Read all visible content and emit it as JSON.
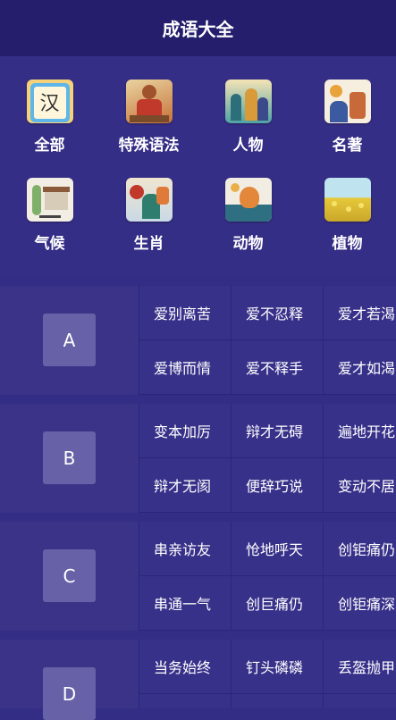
{
  "header": {
    "title": "成语大全"
  },
  "categories": [
    {
      "label": "全部",
      "icon": "han-character-icon"
    },
    {
      "label": "特殊语法",
      "icon": "monkey-king-icon"
    },
    {
      "label": "人物",
      "icon": "people-icon"
    },
    {
      "label": "名著",
      "icon": "classics-icon"
    },
    {
      "label": "气候",
      "icon": "weather-icon"
    },
    {
      "label": "生肖",
      "icon": "zodiac-icon"
    },
    {
      "label": "动物",
      "icon": "animal-icon"
    },
    {
      "label": "植物",
      "icon": "plant-icon"
    }
  ],
  "sections": [
    {
      "letter": "A",
      "words": [
        "爱别离苦",
        "爱不忍释",
        "爱才若渴",
        "爱博而情",
        "爱不释手",
        "爱才如渴"
      ]
    },
    {
      "letter": "B",
      "words": [
        "变本加厉",
        "辩才无碍",
        "遍地开花",
        "辩才无阂",
        "便辞巧说",
        "变动不居"
      ]
    },
    {
      "letter": "C",
      "words": [
        "串亲访友",
        "怆地呼天",
        "创钜痛仍",
        "串通一气",
        "创巨痛仍",
        "创钜痛深"
      ]
    },
    {
      "letter": "D",
      "words": [
        "当务始终",
        "钉头磷磷",
        "丢盔抛甲"
      ]
    }
  ]
}
